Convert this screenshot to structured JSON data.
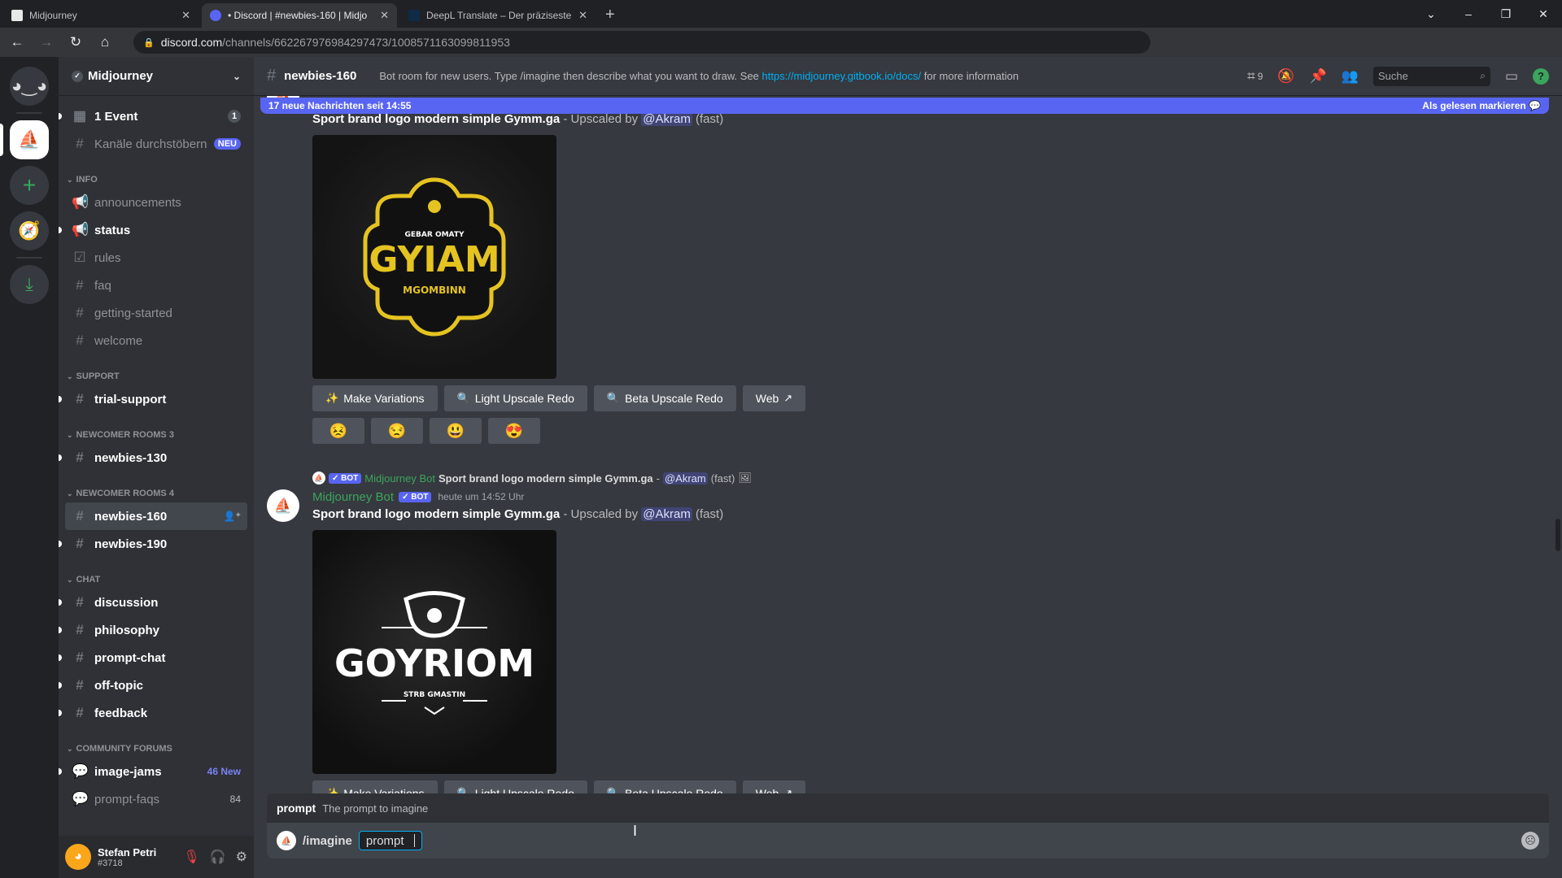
{
  "browser": {
    "tabs": [
      {
        "title": "Midjourney",
        "active": false
      },
      {
        "title": "• Discord | #newbies-160 | Midjo",
        "active": true
      },
      {
        "title": "DeepL Translate – Der präziseste",
        "active": false
      }
    ],
    "new_tab": "+",
    "url_host": "discord.com",
    "url_path": "/channels/662267976984297473/1008571163099811953",
    "window_controls": [
      "⌄",
      "–",
      "❐",
      "✕"
    ],
    "extensions": [
      "key-icon",
      "share-icon",
      "star-icon",
      "abp-icon",
      "notes-icon",
      "bird-icon",
      "globe-icon",
      "translate-icon",
      "download-icon",
      "tool-icon",
      "bracket-icon",
      "camera-icon",
      "puzzle-icon",
      "sidepanel-icon",
      "profile-icon",
      "menu-icon"
    ]
  },
  "server": {
    "name": "Midjourney",
    "event": {
      "label": "1 Event",
      "count": "1"
    },
    "browse": {
      "label": "Kanäle durchstöbern",
      "badge": "NEU"
    },
    "categories": [
      {
        "name": "INFO",
        "channels": [
          {
            "name": "announcements",
            "icon": "announcement",
            "unread": false
          },
          {
            "name": "status",
            "icon": "announcement",
            "unread": true
          },
          {
            "name": "rules",
            "icon": "rules",
            "unread": false
          },
          {
            "name": "faq",
            "icon": "hash",
            "unread": false
          },
          {
            "name": "getting-started",
            "icon": "hash",
            "unread": false
          },
          {
            "name": "welcome",
            "icon": "hash",
            "unread": false
          }
        ]
      },
      {
        "name": "SUPPORT",
        "channels": [
          {
            "name": "trial-support",
            "icon": "hash",
            "unread": true
          }
        ]
      },
      {
        "name": "NEWCOMER ROOMS 3",
        "channels": [
          {
            "name": "newbies-130",
            "icon": "thread",
            "unread": true
          }
        ]
      },
      {
        "name": "NEWCOMER ROOMS 4",
        "channels": [
          {
            "name": "newbies-160",
            "icon": "thread",
            "unread": false,
            "active": true
          },
          {
            "name": "newbies-190",
            "icon": "thread",
            "unread": true
          }
        ]
      },
      {
        "name": "CHAT",
        "channels": [
          {
            "name": "discussion",
            "icon": "hash",
            "unread": true
          },
          {
            "name": "philosophy",
            "icon": "hash",
            "unread": true
          },
          {
            "name": "prompt-chat",
            "icon": "thread",
            "unread": true
          },
          {
            "name": "off-topic",
            "icon": "hash",
            "unread": true
          },
          {
            "name": "feedback",
            "icon": "hash",
            "unread": true
          }
        ]
      },
      {
        "name": "COMMUNITY FORUMS",
        "channels": [
          {
            "name": "image-jams",
            "icon": "forum",
            "unread": true,
            "extra": "46 New"
          },
          {
            "name": "prompt-faqs",
            "icon": "forum",
            "unread": false,
            "extra": "84"
          }
        ]
      }
    ]
  },
  "user": {
    "name": "Stefan Petri",
    "tag": "#3718"
  },
  "channel": {
    "name": "newbies-160",
    "topic_prefix": "Bot room for new users. Type /imagine then describe what you want to draw. See ",
    "topic_link": "https://midjourney.gitbook.io/docs/",
    "topic_suffix": " for more information",
    "threads_count": "9",
    "search_placeholder": "Suche"
  },
  "new_messages_bar": {
    "label": "17 neue Nachrichten seit 14:55",
    "action": "Als gelesen markieren"
  },
  "messages": [
    {
      "prompt": "Sport brand logo modern simple Gymm.ga",
      "sep": " - Upscaled by ",
      "mention": "@Akram",
      "mode": "(fast)",
      "image": {
        "title": "GYIAM",
        "top_left": "GEBAR",
        "top_right": "OMATY",
        "bottom": "MGOMBINN"
      },
      "buttons": [
        "Make Variations",
        "Light Upscale Redo",
        "Beta Upscale Redo",
        "Web"
      ],
      "reactions": [
        "😣",
        "😒",
        "😃",
        "😍"
      ]
    },
    {
      "reply": {
        "author": "Midjourney Bot",
        "badge": "✓ BOT",
        "prompt": "Sport brand logo modern simple Gymm.ga",
        "sep": " - ",
        "mention": "@Akram",
        "mode": "(fast)"
      },
      "author": "Midjourney Bot",
      "badge": "✓ BOT",
      "timestamp": "heute um 14:52 Uhr",
      "prompt": "Sport brand logo modern simple Gymm.ga",
      "sep": " - Upscaled by ",
      "mention": "@Akram",
      "mode": "(fast)",
      "image": {
        "title": "GOYRIOM",
        "sub": "STRB GMASTIN"
      },
      "buttons": [
        "Make Variations",
        "Light Upscale Redo",
        "Beta Upscale Redo",
        "Web"
      ]
    }
  ],
  "composer": {
    "option_name": "prompt",
    "option_desc": "The prompt to imagine",
    "command": "/imagine",
    "option_value": "prompt"
  },
  "colors": {
    "accent": "#5865f2",
    "bot_name": "#3ba55d",
    "link": "#00aff4",
    "logo_yellow": "#e5c320"
  }
}
